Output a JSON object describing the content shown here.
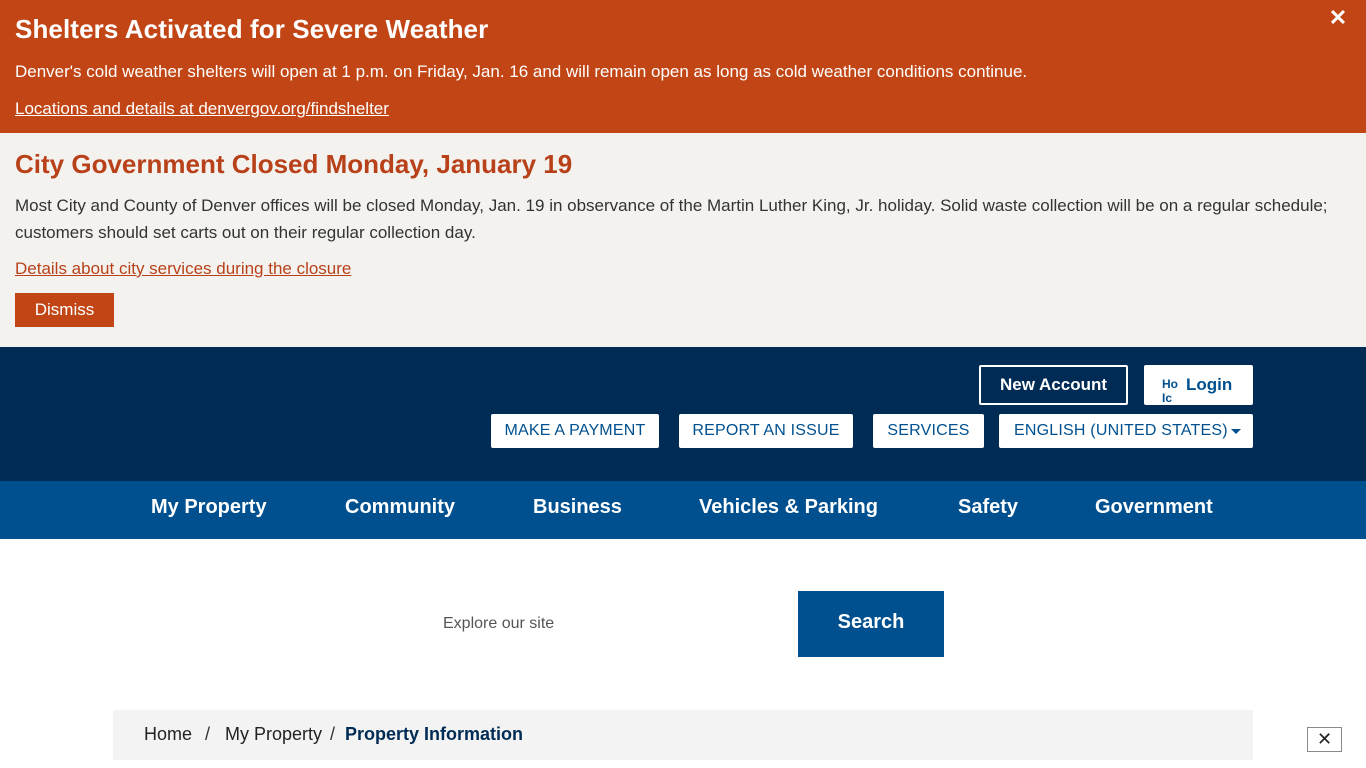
{
  "alerts": {
    "severe": {
      "title": "Shelters Activated for Severe Weather",
      "body": "Denver's cold weather shelters will open at 1 p.m. on Friday, Jan. 16 and will remain open as long as cold weather conditions continue.",
      "link": "Locations and details at denvergov.org/findshelter",
      "close": "✕"
    },
    "closure": {
      "title": "City Government Closed Monday, January 19",
      "body": "Most City and County of Denver offices will be closed Monday, Jan. 19 in observance of the Martin Luther King, Jr. holiday. Solid waste collection will be on a regular schedule; customers should set carts out on their regular collection day.",
      "link": "Details about city services during the closure",
      "dismiss": "Dismiss"
    }
  },
  "header": {
    "new_account": "New Account",
    "login": "Login",
    "login_icon_alt": "Ho Ic",
    "utility": {
      "payment": "MAKE A PAYMENT",
      "report": "REPORT AN ISSUE",
      "services": "SERVICES",
      "language": "ENGLISH (UNITED STATES)"
    }
  },
  "nav": {
    "items": [
      "My Property",
      "Community",
      "Business",
      "Vehicles & Parking",
      "Safety",
      "Government"
    ]
  },
  "search": {
    "placeholder": "Explore our site",
    "button": "Search"
  },
  "breadcrumb": {
    "home": "Home",
    "separator": "/",
    "parent": "My Property",
    "current": "Property Information"
  },
  "corner_close": "✕",
  "colors": {
    "alert_orange": "#c24615",
    "closure_bg": "#f3f2ef",
    "header_navy": "#002b54",
    "nav_blue": "#00508f"
  }
}
